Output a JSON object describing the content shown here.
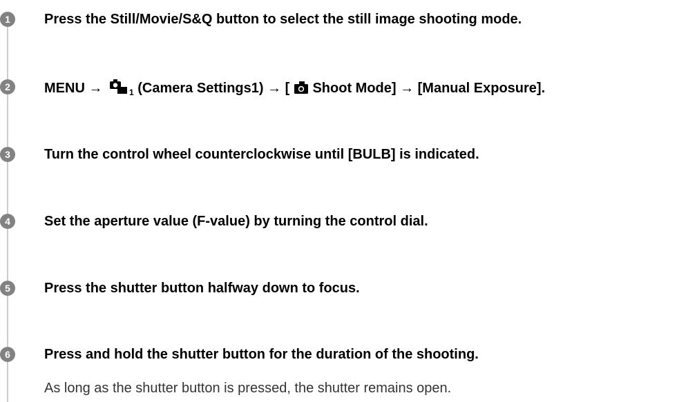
{
  "steps": [
    {
      "number": "1",
      "text": "Press the Still/Movie/S&Q button to select the still image shooting mode."
    },
    {
      "number": "2",
      "parts": {
        "prefix": "MENU →",
        "menu_sub": "1",
        "mid": "(Camera Settings1) → [",
        "suffix": "Shoot Mode] → [Manual Exposure]."
      },
      "icons": [
        "camera-settings-icon",
        "still-camera-icon"
      ]
    },
    {
      "number": "3",
      "text": "Turn the control wheel counterclockwise until [BULB] is indicated."
    },
    {
      "number": "4",
      "text": "Set the aperture value (F-value) by turning the control dial."
    },
    {
      "number": "5",
      "text": "Press the shutter button halfway down to focus."
    },
    {
      "number": "6",
      "text": "Press and hold the shutter button for the duration of the shooting.",
      "note": "As long as the shutter button is pressed, the shutter remains open."
    }
  ],
  "colors": {
    "step_circle": "#828282",
    "rail": "#cccccc",
    "note_text": "#333333"
  }
}
